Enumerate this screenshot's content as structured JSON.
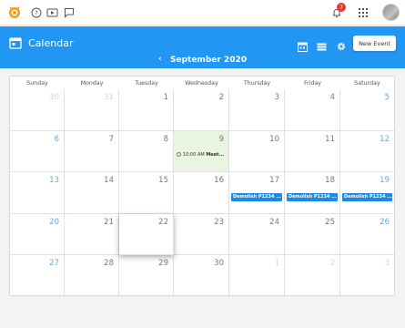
{
  "topbar": {
    "icons": [
      "app-logo-icon",
      "help-icon",
      "video-icon",
      "chat-icon"
    ],
    "notification_count": "7"
  },
  "header": {
    "title": "Calendar",
    "month_label": "September 2020",
    "prev": "‹",
    "next": "›",
    "new_event_label": "New Event"
  },
  "calendar": {
    "weekdays": [
      "Sunday",
      "Monday",
      "Tuesday",
      "Wednesday",
      "Thursday",
      "Friday",
      "Saturday"
    ],
    "weeks": [
      [
        "30",
        "31",
        "1",
        "2",
        "3",
        "4",
        "5"
      ],
      [
        "6",
        "7",
        "8",
        "9",
        "10",
        "11",
        "12"
      ],
      [
        "13",
        "14",
        "15",
        "16",
        "17",
        "18",
        "19"
      ],
      [
        "20",
        "21",
        "22",
        "23",
        "24",
        "25",
        "26"
      ],
      [
        "27",
        "28",
        "29",
        "30",
        "1",
        "2",
        "3"
      ]
    ],
    "events": {
      "wed9": {
        "time": "10:00 AM",
        "title": "Meet..."
      },
      "thu17": "Demolish P1234 ...",
      "fri18": "Demolish P1234 ...",
      "sat19": "Demolish P1234 ..."
    },
    "colors": {
      "today_bg": "#e8f5e0",
      "weekend_text": "#64a8e0",
      "other_month_text": "#d4d4d4",
      "event_bg": "#1e88e5",
      "header_bg": "#2196f3"
    }
  }
}
